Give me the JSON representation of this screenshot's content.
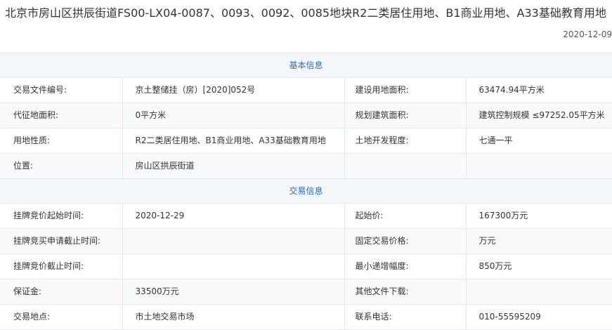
{
  "page": {
    "title": "北京市房山区拱辰街道FS00-LX04-0087、0093、0092、0085地块R2二类居住用地、B1商业用地、A33基础教育用地",
    "date": "2020-12-09"
  },
  "basic": {
    "header": "基本信息",
    "rows": [
      {
        "l1": "交易文件编号:",
        "v1": "京土整储挂（房）[2020]052号",
        "l2": "建设用地面积:",
        "v2": "63474.94平方米"
      },
      {
        "l1": "代征地面积:",
        "v1": "0平方米",
        "l2": "规划建筑面积:",
        "v2": "建筑控制规模 ≤97252.05平方米"
      },
      {
        "l1": "用地性质:",
        "v1": "R2二类居住用地、B1商业用地、A33基础教育用地",
        "l2": "土地开发程度:",
        "v2": "七通一平"
      },
      {
        "l1": "位置:",
        "v1": "房山区拱辰街道",
        "l2": "",
        "v2": ""
      }
    ]
  },
  "trade": {
    "header": "交易信息",
    "rows": [
      {
        "l1": "挂牌竞价起始时间:",
        "v1": "2020-12-29",
        "l2": "起始价:",
        "v2": "167300万元"
      },
      {
        "l1": "挂牌竞买申请截止时间:",
        "v1": "",
        "l2": "固定交易价格:",
        "v2": "万元"
      },
      {
        "l1": "挂牌竞价截止时间:",
        "v1": "",
        "l2": "最小递增幅度:",
        "v2": "850万元"
      },
      {
        "l1": "保证金:",
        "v1": "33500万元",
        "l2": "其他文件下载:",
        "v2": ""
      },
      {
        "l1": "交易地点:",
        "v1": "市土地交易市场",
        "l2": "联系电话:",
        "v2": "010-55595209"
      }
    ]
  }
}
